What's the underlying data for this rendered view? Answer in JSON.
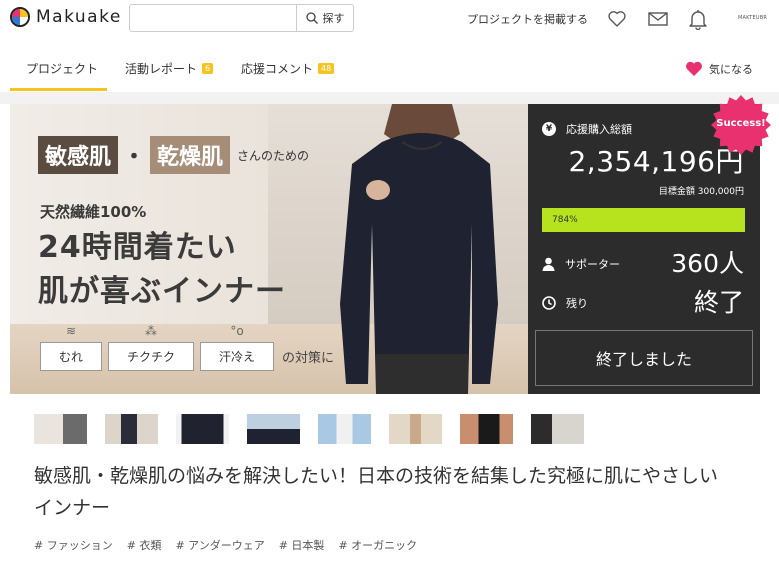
{
  "header": {
    "logo_text": "Makuake",
    "search": {
      "value": "",
      "placeholder": "",
      "button_label": "探す"
    },
    "post_link": "プロジェクトを掲載する",
    "icons": [
      "heart-icon",
      "mail-icon",
      "bell-icon"
    ],
    "account_label": "MAKTEUBR"
  },
  "tabs": {
    "items": [
      {
        "label": "プロジェクト",
        "badge": ""
      },
      {
        "label": "活動レポート",
        "badge": "6"
      },
      {
        "label": "応援コメント",
        "badge": "48"
      }
    ],
    "favorite_label": "気になる"
  },
  "hero": {
    "chip1": "敏感肌",
    "dot": "・",
    "chip2": "乾燥肌",
    "sanno": "さんのための",
    "fiber": "天然繊維100%",
    "line1": "24時間着たい",
    "line2": "肌が喜ぶインナー",
    "pills": [
      "むれ",
      "チクチク",
      "汗冷え"
    ],
    "taisaku": "の対策に",
    "colors": {
      "chip1": "#5b4c41",
      "chip2": "#a58d77"
    }
  },
  "funding": {
    "total_label": "応援購入総額",
    "yen_symbol": "¥",
    "amount": "2,354,196円",
    "goal": "目標金額 300,000円",
    "progress_label": "784%",
    "progress_fraction": 1.0,
    "supporters_label": "サポーター",
    "supporters_value": "360人",
    "remaining_label": "残り",
    "remaining_value": "終了",
    "ended_button": "終了しました",
    "success_badge": "Success!",
    "colors": {
      "panel": "#2c2c2c",
      "progress": "#b6e31e",
      "success": "#e8316e"
    }
  },
  "thumbnails": [
    "thumb-1",
    "thumb-2",
    "thumb-3",
    "thumb-4",
    "thumb-5",
    "thumb-6",
    "thumb-7",
    "thumb-8"
  ],
  "project": {
    "title": "敏感肌・乾燥肌の悩みを解決したい！日本の技術を結集した究極に肌にやさしいインナー",
    "tags": [
      "# ファッション",
      "# 衣類",
      "# アンダーウェア",
      "# 日本製",
      "# オーガニック"
    ]
  }
}
